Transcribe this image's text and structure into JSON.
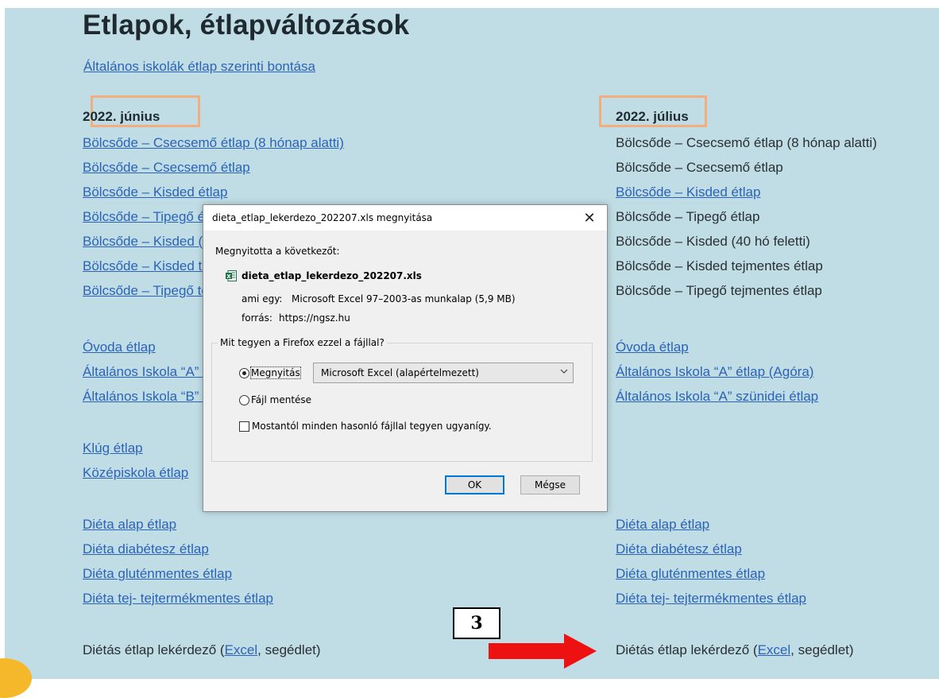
{
  "page": {
    "title": "Etlapok, étlapváltozások",
    "top_link": "Általános iskolák étlap szerinti bontása"
  },
  "left_column": {
    "heading": "2022. június",
    "nursery_items": [
      "Bölcsőde – Csecsemő étlap (8 hónap alatti)",
      "Bölcsőde – Csecsemő étlap",
      "Bölcsőde – Kisded étlap",
      "Bölcsőde – Tipegő étlap",
      "Bölcsőde – Kisded (40 hó feletti)",
      "Bölcsőde – Kisded tejmentes étlap",
      "Bölcsőde – Tipegő tejmentes étlap"
    ],
    "school_items": [
      "Óvoda étlap",
      "Általános Iskola “A” étlap (Agóra)",
      "Általános Iskola “B” étlap"
    ],
    "other_items": [
      "Klúg étlap",
      "Középiskola étlap"
    ],
    "diet_items": [
      "Diéta alap étlap",
      "Diéta diabétesz étlap",
      "Diéta gluténmentes étlap",
      "Diéta tej- tejtermékmentes étlap"
    ],
    "query": {
      "prefix": "Diétás étlap lekérdező (",
      "link": "Excel",
      "suffix": ", segédlet)"
    }
  },
  "right_column": {
    "heading": "2022. július",
    "nursery_items": [
      {
        "label": "Bölcsőde – Csecsemő étlap (8 hónap alatti)",
        "link": false
      },
      {
        "label": "Bölcsőde – Csecsemő étlap",
        "link": false
      },
      {
        "label": "Bölcsőde – Kisded étlap",
        "link": true
      },
      {
        "label": "Bölcsőde – Tipegő étlap",
        "link": false
      },
      {
        "label": "Bölcsőde – Kisded (40 hó feletti)",
        "link": false
      },
      {
        "label": "Bölcsőde – Kisded tejmentes étlap",
        "link": false
      },
      {
        "label": "Bölcsőde – Tipegő tejmentes étlap",
        "link": false
      }
    ],
    "school_items": [
      "Óvoda étlap",
      "Általános Iskola “A” étlap (Agóra)",
      "Általános Iskola “A” szünidei étlap"
    ],
    "diet_items": [
      "Diéta alap étlap",
      "Diéta diabétesz étlap",
      "Diéta gluténmentes étlap",
      "Diéta tej- tejtermékmentes étlap"
    ],
    "query": {
      "prefix": "Diétás étlap lekérdező (",
      "link": "Excel",
      "suffix": ", segédlet)"
    }
  },
  "annotation": {
    "step_number": "3",
    "arrow_color": "#ee1111",
    "highlight_color": "#f3ad7e"
  },
  "dialog": {
    "title": "dieta_etlap_lekerdezo_202207.xls megnyitása",
    "close_icon": "close-icon",
    "opened_label": "Megnyitotta a következőt:",
    "file_icon": "excel-file-icon",
    "filename": "dieta_etlap_lekerdezo_202207.xls",
    "type_label": "ami egy:",
    "type_value": "Microsoft Excel 97–2003-as munkalap (5,9 MB)",
    "source_label": "forrás:",
    "source_value": "https://ngsz.hu",
    "question": "Mit tegyen a Firefox ezzel a fájllal?",
    "open_with_label": "Megnyitás",
    "open_with_selected": true,
    "open_with_app": "Microsoft Excel (alapértelmezett)",
    "save_label": "Fájl mentése",
    "remember_label": "Mostantól minden hasonló fájllal tegyen ugyanígy.",
    "remember_checked": false,
    "ok_label": "OK",
    "cancel_label": "Mégse"
  }
}
